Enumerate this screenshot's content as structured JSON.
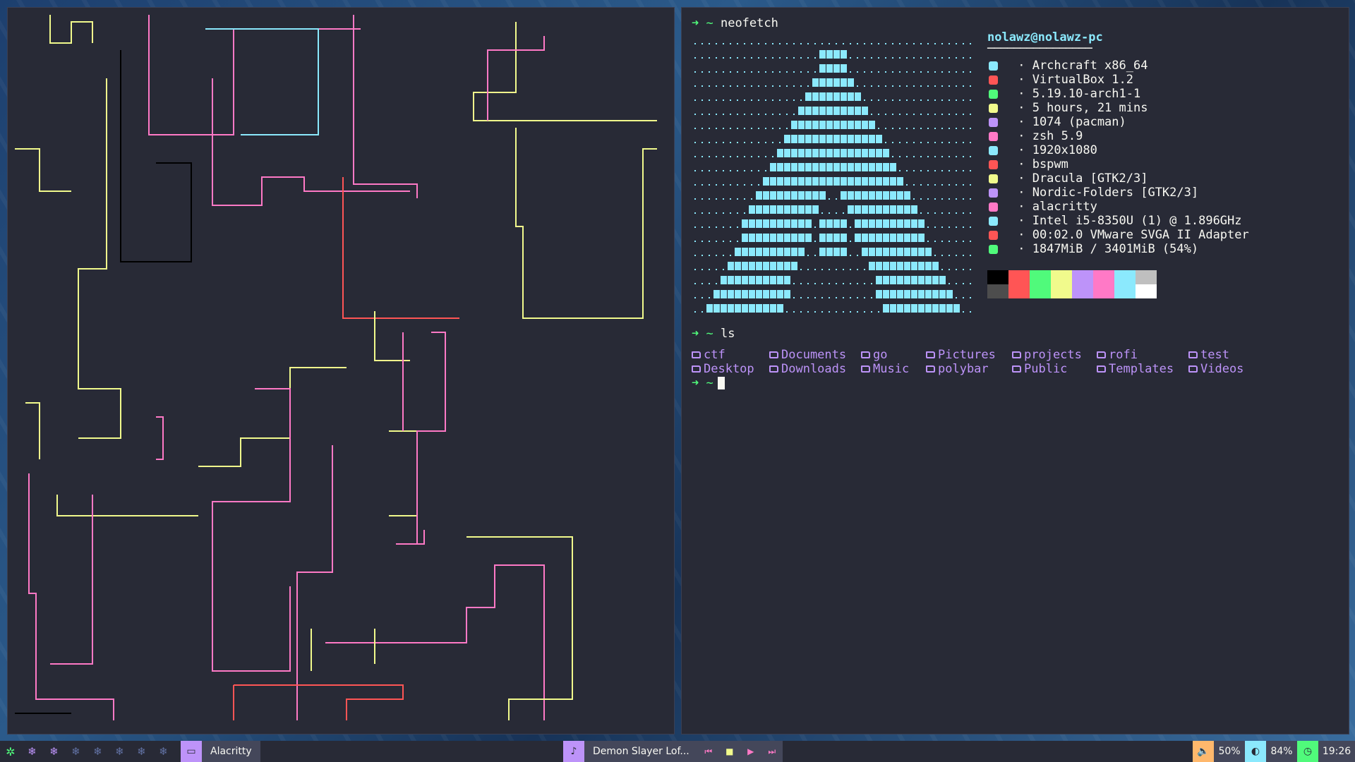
{
  "right_terminal": {
    "cmd1_prompt": "➜ ~",
    "cmd1": "neofetch",
    "info_title": "nolawz@nolawz-pc",
    "info_separator": "────────────────",
    "info_rows": [
      {
        "text": " · Archcraft x86_64",
        "icon": "arch-icon",
        "color": "#8be9fd"
      },
      {
        "text": " · VirtualBox 1.2",
        "icon": "host-icon",
        "color": "#ff5555"
      },
      {
        "text": " · 5.19.10-arch1-1",
        "icon": "kernel-icon",
        "color": "#50fa7b"
      },
      {
        "text": " · 5 hours, 21 mins",
        "icon": "uptime-icon",
        "color": "#f1fa8c"
      },
      {
        "text": " · 1074 (pacman)",
        "icon": "packages-icon",
        "color": "#bd93f9"
      },
      {
        "text": " · zsh 5.9",
        "icon": "shell-icon",
        "color": "#ff79c6"
      },
      {
        "text": " · 1920x1080",
        "icon": "resolution-icon",
        "color": "#8be9fd"
      },
      {
        "text": " · bspwm",
        "icon": "wm-icon",
        "color": "#ff5555"
      },
      {
        "text": " · Dracula [GTK2/3]",
        "icon": "theme-icon",
        "color": "#f1fa8c"
      },
      {
        "text": " · Nordic-Folders [GTK2/3]",
        "icon": "icons-icon",
        "color": "#bd93f9"
      },
      {
        "text": " · alacritty",
        "icon": "terminal-icon",
        "color": "#ff79c6"
      },
      {
        "text": " · Intel i5-8350U (1) @ 1.896GHz",
        "icon": "cpu-icon",
        "color": "#8be9fd"
      },
      {
        "text": " · 00:02.0 VMware SVGA II Adapter",
        "icon": "gpu-icon",
        "color": "#ff5555"
      },
      {
        "text": " · 1847MiB / 3401MiB (54%)",
        "icon": "memory-icon",
        "color": "#50fa7b"
      }
    ],
    "swatches_top": [
      "#000000",
      "#ff5555",
      "#50fa7b",
      "#f1fa8c",
      "#bd93f9",
      "#ff79c6",
      "#8be9fd",
      "#bfbfbf"
    ],
    "swatches_bottom": [
      "#4d4d4d",
      "#ff5555",
      "#50fa7b",
      "#f1fa8c",
      "#bd93f9",
      "#ff79c6",
      "#8be9fd",
      "#ffffff"
    ],
    "cmd2_prompt": "➜ ~",
    "cmd2": "ls",
    "ls_row1": [
      "ctf",
      "Documents",
      "go",
      "Pictures",
      "projects",
      "rofi",
      "test"
    ],
    "ls_row2": [
      "Desktop",
      "Downloads",
      "Music",
      "polybar",
      "Public",
      "Templates",
      "Videos"
    ],
    "cmd3_prompt": "➜ ~"
  },
  "taskbar": {
    "launcher_icon": "gear-icon",
    "workspaces": [
      "❄",
      "❄",
      "❄",
      "❄",
      "❄",
      "❄",
      "❄",
      "❄"
    ],
    "window_title": "Alacritty",
    "music_title": "Demon Slayer Lof...",
    "volume": "50%",
    "brightness": "84%",
    "clock": "19:26",
    "accent": "#bd93f9",
    "volume_color": "#ffb86c",
    "brightness_color": "#8be9fd",
    "clock_color": "#50fa7b"
  }
}
